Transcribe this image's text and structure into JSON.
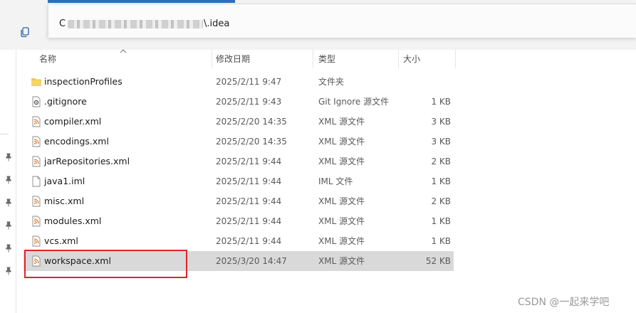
{
  "address_bar": {
    "path_prefix": "C",
    "path_tail": "\\.idea"
  },
  "columns": {
    "name": "名称",
    "modified": "修改日期",
    "type": "类型",
    "size": "大小"
  },
  "files": [
    {
      "name": "inspectionProfiles",
      "modified": "2025/2/11 9:47",
      "type": "文件夹",
      "size": "",
      "icon": "folder-icon"
    },
    {
      "name": ".gitignore",
      "modified": "2025/2/11 9:43",
      "type": "Git Ignore 源文件",
      "size": "1 KB",
      "icon": "gear-file-icon"
    },
    {
      "name": "compiler.xml",
      "modified": "2025/2/20 14:35",
      "type": "XML 源文件",
      "size": "3 KB",
      "icon": "xml-file-icon"
    },
    {
      "name": "encodings.xml",
      "modified": "2025/2/20 14:35",
      "type": "XML 源文件",
      "size": "3 KB",
      "icon": "xml-file-icon"
    },
    {
      "name": "jarRepositories.xml",
      "modified": "2025/2/11 9:44",
      "type": "XML 源文件",
      "size": "2 KB",
      "icon": "xml-file-icon"
    },
    {
      "name": "java1.iml",
      "modified": "2025/2/11 9:44",
      "type": "IML 文件",
      "size": "1 KB",
      "icon": "blank-file-icon"
    },
    {
      "name": "misc.xml",
      "modified": "2025/2/11 9:44",
      "type": "XML 源文件",
      "size": "2 KB",
      "icon": "xml-file-icon"
    },
    {
      "name": "modules.xml",
      "modified": "2025/2/11 9:44",
      "type": "XML 源文件",
      "size": "1 KB",
      "icon": "xml-file-icon"
    },
    {
      "name": "vcs.xml",
      "modified": "2025/2/11 9:44",
      "type": "XML 源文件",
      "size": "1 KB",
      "icon": "xml-file-icon"
    },
    {
      "name": "workspace.xml",
      "modified": "2025/3/20 14:47",
      "type": "XML 源文件",
      "size": "52 KB",
      "icon": "xml-file-icon",
      "selected": true
    }
  ],
  "watermark": "CSDN @一起来学吧",
  "colors": {
    "selection": "#d9d9d9",
    "highlight_border": "#e0242b",
    "folder": "#f3c64e",
    "xml_accent": "#e07a2e"
  }
}
